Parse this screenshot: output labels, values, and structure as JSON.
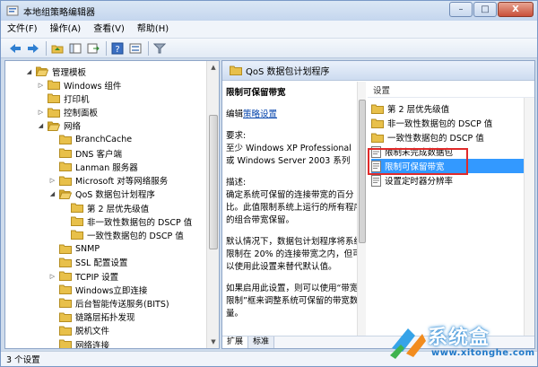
{
  "window": {
    "title": "本地组策略编辑器",
    "buttons": {
      "minimize": "–",
      "maximize": "□",
      "close": "X"
    }
  },
  "menu": {
    "items": [
      "文件(F)",
      "操作(A)",
      "查看(V)",
      "帮助(H)"
    ]
  },
  "tree": {
    "items": [
      {
        "label": "管理模板",
        "depth": 0,
        "expanded": true
      },
      {
        "label": "Windows 组件",
        "depth": 1,
        "expanded": false
      },
      {
        "label": "打印机",
        "depth": 1,
        "expanded": null
      },
      {
        "label": "控制面板",
        "depth": 1,
        "expanded": false
      },
      {
        "label": "网络",
        "depth": 1,
        "expanded": true
      },
      {
        "label": "BranchCache",
        "depth": 2,
        "expanded": null
      },
      {
        "label": "DNS 客户端",
        "depth": 2,
        "expanded": null
      },
      {
        "label": "Lanman 服务器",
        "depth": 2,
        "expanded": null
      },
      {
        "label": "Microsoft 对等网络服务",
        "depth": 2,
        "expanded": false
      },
      {
        "label": "QoS 数据包计划程序",
        "depth": 2,
        "expanded": true
      },
      {
        "label": "第 2 层优先级值",
        "depth": 3,
        "expanded": null
      },
      {
        "label": "非一致性数据包的 DSCP 值",
        "depth": 3,
        "expanded": null
      },
      {
        "label": "一致性数据包的 DSCP 值",
        "depth": 3,
        "expanded": null
      },
      {
        "label": "SNMP",
        "depth": 2,
        "expanded": null
      },
      {
        "label": "SSL 配置设置",
        "depth": 2,
        "expanded": null
      },
      {
        "label": "TCPIP 设置",
        "depth": 2,
        "expanded": false
      },
      {
        "label": "Windows立即连接",
        "depth": 2,
        "expanded": null
      },
      {
        "label": "后台智能传送服务(BITS)",
        "depth": 2,
        "expanded": null
      },
      {
        "label": "链路层拓扑发现",
        "depth": 2,
        "expanded": null
      },
      {
        "label": "脱机文件",
        "depth": 2,
        "expanded": null
      },
      {
        "label": "网络连接",
        "depth": 2,
        "expanded": null
      }
    ]
  },
  "right": {
    "header": "QoS 数据包计划程序",
    "desc": {
      "title": "限制可保留带宽",
      "edit_prefix": "编辑",
      "edit_link": "策略设置",
      "req_label": "要求:",
      "req_text": "至少 Windows XP Professional 或 Windows Server 2003 系列",
      "desc_label": "描述:",
      "desc_text": "确定系统可保留的连接带宽的百分比。此值限制系统上运行的所有程序的组合带宽保留。",
      "default_text": "默认情况下，数据包计划程序将系统限制在 20% 的连接带宽之内，但可以使用此设置来替代默认值。",
      "enable_text": "如果启用此设置，则可以使用“带宽限制”框来调整系统可保留的带宽数量。"
    },
    "list": {
      "header": "设置",
      "items": [
        {
          "label": "第 2 层优先级值",
          "type": "folder"
        },
        {
          "label": "非一致性数据包的 DSCP 值",
          "type": "folder"
        },
        {
          "label": "一致性数据包的 DSCP 值",
          "type": "folder"
        },
        {
          "label": "限制未完成数据包",
          "type": "setting"
        },
        {
          "label": "限制可保留带宽",
          "type": "setting",
          "selected": true
        },
        {
          "label": "设置定时器分辨率",
          "type": "setting"
        }
      ]
    },
    "tabs": [
      "扩展",
      "标准"
    ]
  },
  "status": {
    "text": "3 个设置"
  },
  "watermark": {
    "brand": "系统盒",
    "url": "www.xitonghe.com"
  },
  "colors": {
    "selection": "#3399ff",
    "highlight_box": "#e02a2a",
    "folder": "#e8c04a"
  }
}
